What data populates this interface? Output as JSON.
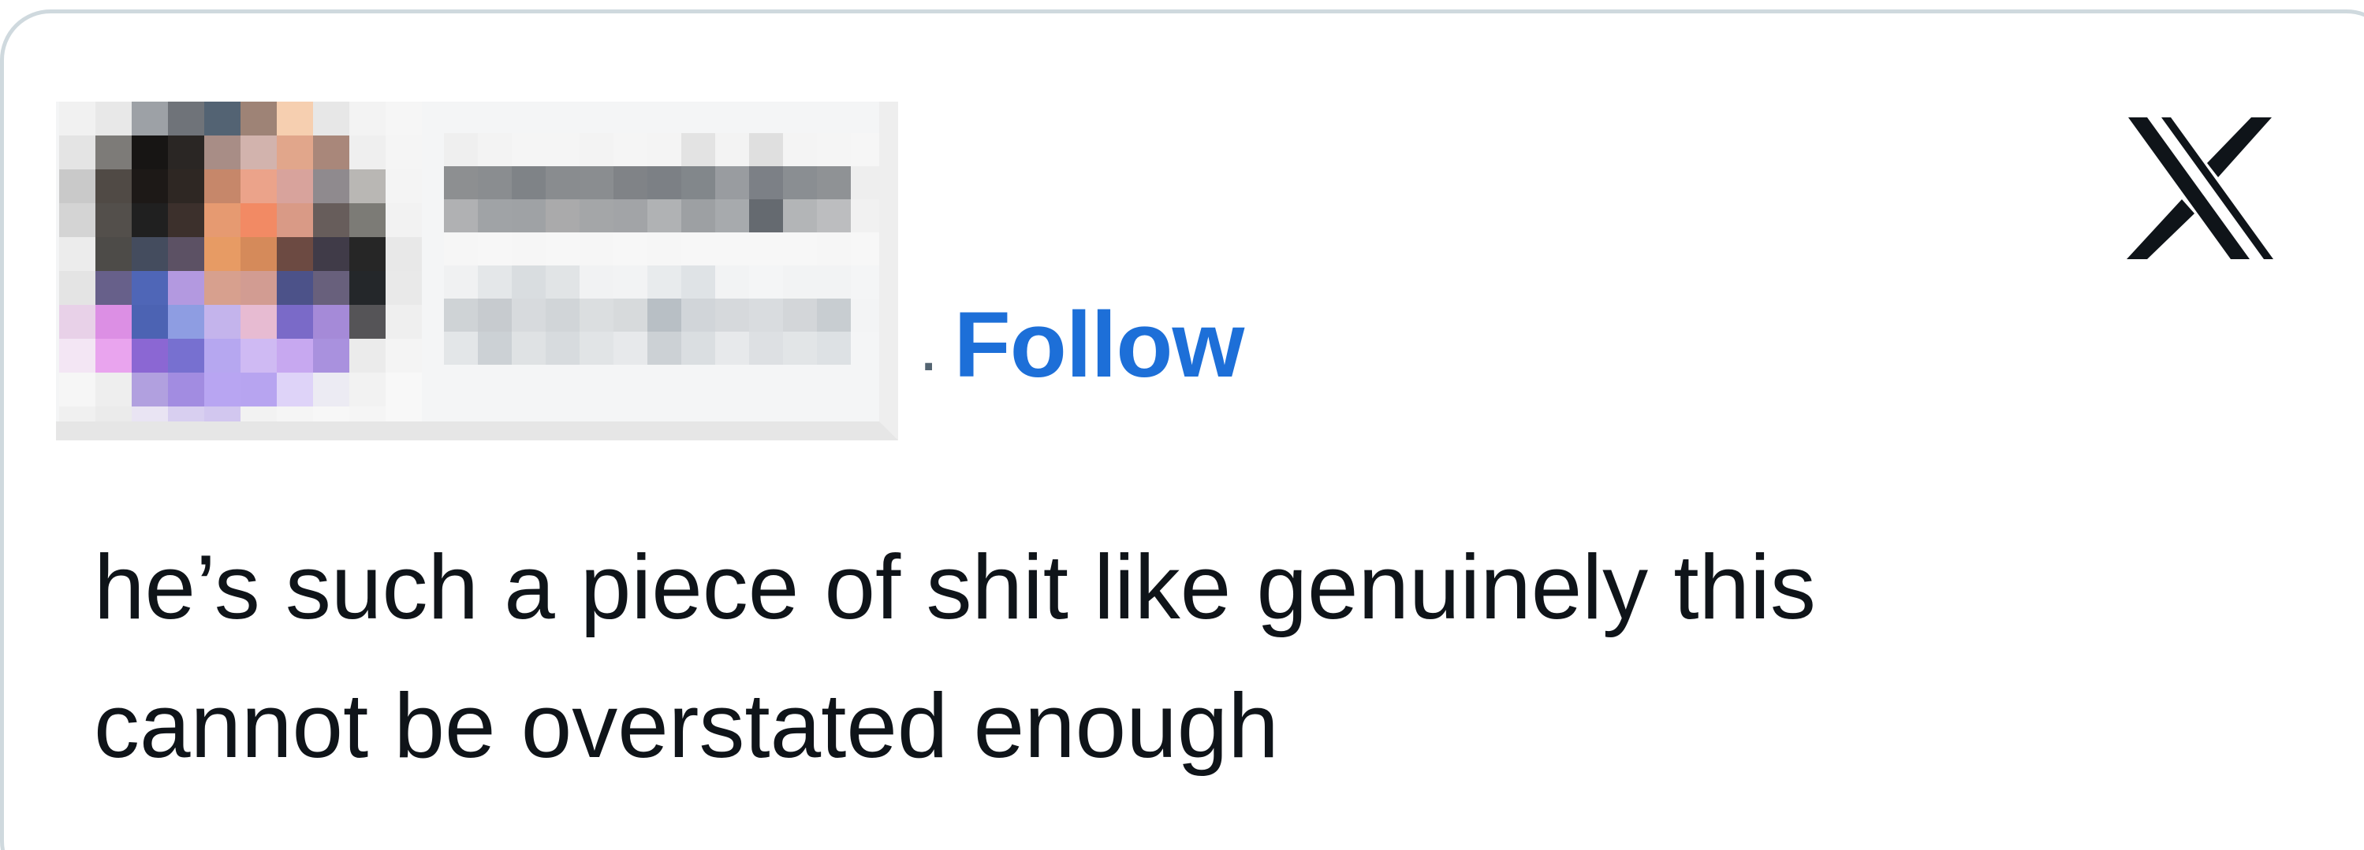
{
  "post": {
    "follow_separator": "·",
    "follow_label": "Follow",
    "text_line_1": "he’s such a piece of shit like genuinely this",
    "text_line_2": "cannot be overstated enough",
    "brand_icon": "x-logo-icon"
  },
  "colors": {
    "follow_blue": "#1d6fd8",
    "text_dark": "#0f1419",
    "card_border": "#cfd9de",
    "logo_black": "#0f1419"
  }
}
